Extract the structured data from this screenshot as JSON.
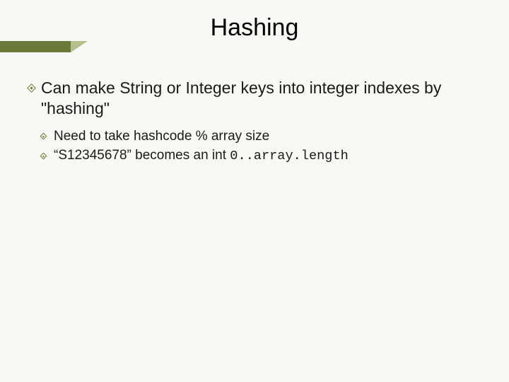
{
  "title": "Hashing",
  "bullets": {
    "main": "Can make String or Integer keys into integer indexes by \"hashing\"",
    "sub1": "Need to  take hashcode % array size",
    "sub2_prefix": "“S12345678” becomes an int ",
    "sub2_code": "0..array.length"
  }
}
